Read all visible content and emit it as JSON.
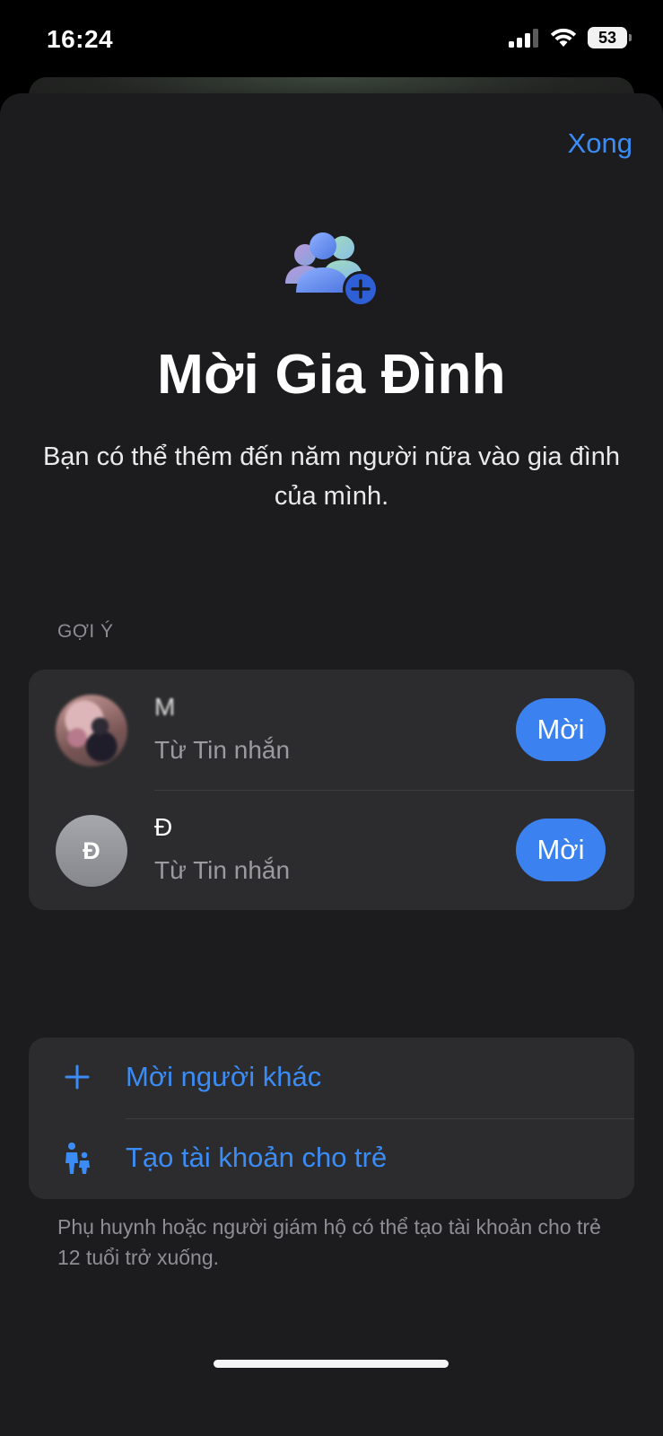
{
  "status_bar": {
    "time": "16:24",
    "battery_level": "53"
  },
  "header": {
    "done_label": "Xong"
  },
  "hero": {
    "icon": "family-add-icon",
    "title": "Mời Gia Đình",
    "subtitle": "Bạn có thể thêm đến năm người nữa vào gia đình của mình."
  },
  "suggestions": {
    "section_label": "GỢI Ý",
    "items": [
      {
        "name": "M",
        "source": "Từ Tin nhắn",
        "avatar_initial": "",
        "invite_label": "Mời"
      },
      {
        "name": "Đ",
        "source": "Từ Tin nhắn",
        "avatar_initial": "Đ",
        "invite_label": "Mời"
      }
    ]
  },
  "actions": {
    "items": [
      {
        "icon": "plus-icon",
        "label": "Mời người khác"
      },
      {
        "icon": "parent-child-icon",
        "label": "Tạo tài khoản cho trẻ"
      }
    ],
    "footnote": "Phụ huynh hoặc người giám hộ có thể tạo tài khoản cho trẻ 12 tuổi trở xuống."
  },
  "colors": {
    "accent": "#3b8cf5",
    "button": "#3b82f0",
    "sheet": "#1c1c1e",
    "card": "#2c2c2e"
  }
}
